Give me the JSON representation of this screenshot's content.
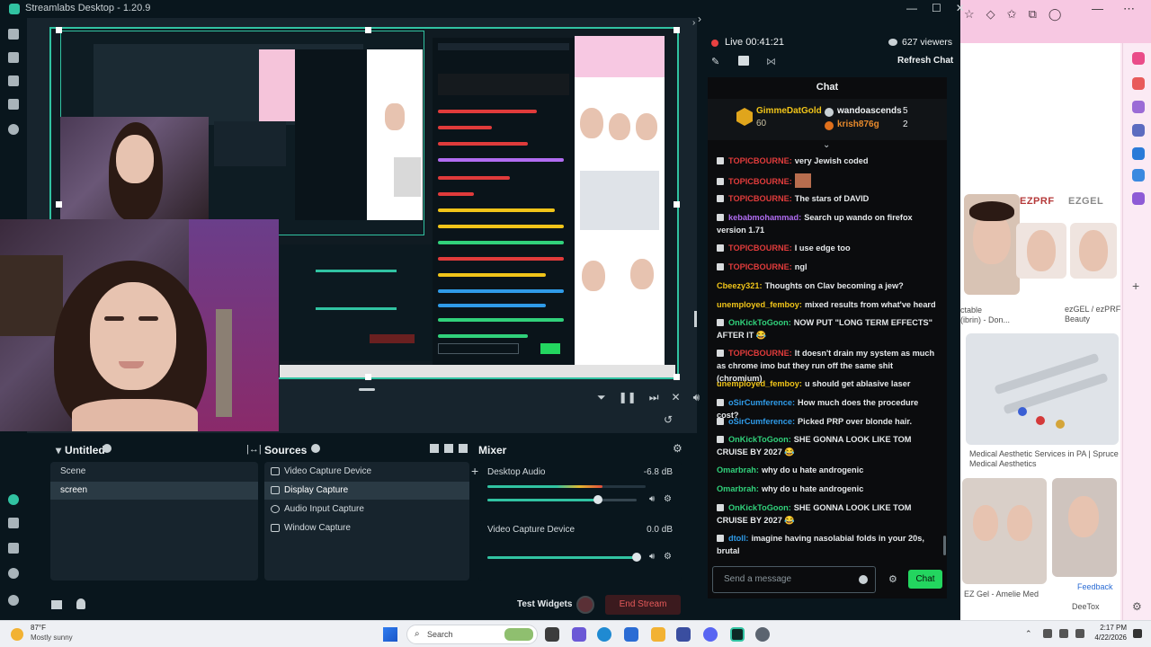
{
  "app": {
    "title": "Streamlabs Desktop - 1.20.9",
    "window_controls": [
      "—",
      "☐",
      "✕"
    ]
  },
  "preview": {
    "controls": [
      "filter-icon",
      "pause-icon",
      "skip-icon",
      "mute-icon",
      "volume-icon"
    ],
    "rotate_icon": "↺"
  },
  "scenes": {
    "title": "Untitled",
    "items": [
      {
        "label": "Scene",
        "selected": false
      },
      {
        "label": "screen",
        "selected": true
      }
    ]
  },
  "sources": {
    "title": "Sources",
    "items": [
      {
        "label": "Video Capture Device",
        "icon": "camera-icon",
        "selected": false
      },
      {
        "label": "Display Capture",
        "icon": "monitor-icon",
        "selected": true
      },
      {
        "label": "Audio Input Capture",
        "icon": "mic-icon",
        "selected": false
      },
      {
        "label": "Window Capture",
        "icon": "window-icon",
        "selected": false
      }
    ]
  },
  "mixer": {
    "title": "Mixer",
    "items": [
      {
        "label": "Desktop Audio",
        "db": "-6.8 dB",
        "level": 0.73,
        "volume": 0.74
      },
      {
        "label": "Video Capture Device",
        "db": "0.0 dB",
        "level": 0.0,
        "volume": 1.0
      }
    ]
  },
  "footer": {
    "test_widgets": "Test Widgets",
    "end_stream": "End Stream"
  },
  "chat_panel": {
    "live": "Live 00:41:21",
    "viewers": "627 viewers",
    "refresh": "Refresh Chat",
    "chat_title": "Chat",
    "leaderboard": [
      {
        "name": "GimmeDatGold",
        "points": "60"
      },
      {
        "name": "wandoascends",
        "points": "5"
      },
      {
        "name": "krish876g",
        "points": "2"
      }
    ],
    "messages": [
      {
        "user": "TOPICBOURNE",
        "text": "very Jewish coded",
        "color": "#e03b3b"
      },
      {
        "user": "TOPICBOURNE",
        "text": "",
        "color": "#e03b3b",
        "emote": true
      },
      {
        "user": "TOPICBOURNE",
        "text": "The stars of DAVID",
        "color": "#e03b3b"
      },
      {
        "user": "kebabmohammad",
        "text": "Search up wando on firefox version 1.71",
        "color": "#b16cf2"
      },
      {
        "user": "TOPICBOURNE",
        "text": "I use edge too",
        "color": "#e03b3b"
      },
      {
        "user": "TOPICBOURNE",
        "text": "ngl",
        "color": "#e03b3b"
      },
      {
        "user": "Cbeezy321",
        "text": "Thoughts on Clav becoming a jew?",
        "color": "#f0c419",
        "nobadge": true
      },
      {
        "user": "unemployed_femboy",
        "text": "mixed results from what've heard",
        "color": "#f0c419",
        "nobadge": true
      },
      {
        "user": "OnKickToGoon",
        "text": "NOW PUT \"LONG TERM EFFECTS\" AFTER IT 😂",
        "color": "#31d17b"
      },
      {
        "user": "TOPICBOURNE",
        "text": "It doesn't drain my system as much as chrome imo but they run off the same shit (chromium)",
        "color": "#e03b3b"
      },
      {
        "user": "unemployed_femboy",
        "text": "u should get ablasive laser",
        "color": "#f0c419",
        "nobadge": true
      },
      {
        "user": "oSirCumference",
        "text": "How much does the procedure cost?",
        "color": "#2f9be8"
      },
      {
        "user": "oSirCumference",
        "text": "Picked PRP over blonde hair.",
        "color": "#2f9be8"
      },
      {
        "user": "OnKickToGoon",
        "text": "SHE GONNA LOOK LIKE TOM CRUISE BY 2027 😂",
        "color": "#31d17b"
      },
      {
        "user": "Omarbrah",
        "text": "why do u hate androgenic",
        "color": "#31d17b",
        "nobadge": true
      },
      {
        "user": "Omarbrah",
        "text": "why do u hate androgenic",
        "color": "#31d17b",
        "nobadge": true
      },
      {
        "user": "OnKickToGoon",
        "text": "SHE GONNA LOOK LIKE TOM CRUISE BY 2027 😂",
        "color": "#31d17b"
      },
      {
        "user": "dtoll",
        "text": "imagine having nasolabial folds in your 20s, brutal",
        "color": "#2f9be8"
      }
    ],
    "input_placeholder": "Send a message",
    "send": "Chat"
  },
  "browser": {
    "captions": [
      "ctable\n(ibrin) - Don...",
      "ezGEL / ezPRF – Allure\nBeauty",
      "Medical Aesthetic Services in PA | Spruce\nMedical Aesthetics",
      "EZ Gel - Amelie Med",
      "DeeTox"
    ],
    "logos": [
      "EZPRF",
      "EZGEL"
    ],
    "feedback": "Feedback"
  },
  "taskbar": {
    "weather_temp": "87°F",
    "weather_desc": "Mostly sunny",
    "search": "Search",
    "time": "2:17 PM",
    "date": "4/22/2026"
  }
}
